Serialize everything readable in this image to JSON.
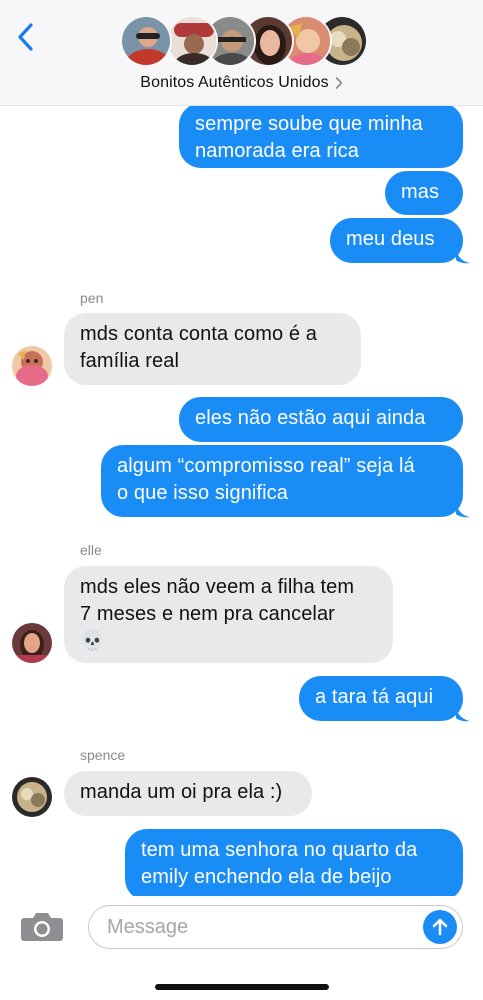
{
  "header": {
    "group_name": "Bonitos Autênticos Unidos",
    "back_icon": "chevron-left-icon",
    "avatar_colors": [
      "#c0392b",
      "#3b2a2a",
      "#4a4a4a",
      "#5b3b30",
      "#d98c70",
      "#2b2b2b"
    ]
  },
  "messages": [
    {
      "dir": "out",
      "text": "sempre soube que minha\nnamorada era rica"
    },
    {
      "dir": "out",
      "text": "mas"
    },
    {
      "dir": "out",
      "text": "meu deus"
    },
    {
      "dir": "in",
      "sender": "pen",
      "text": "mds conta conta como é a\nfamília real"
    },
    {
      "dir": "out",
      "text": "eles não estão aqui ainda"
    },
    {
      "dir": "out",
      "text": "algum “compromisso real” seja lá\no que isso significa"
    },
    {
      "dir": "in",
      "sender": "elle",
      "text": "mds eles não veem a filha tem\n7 meses e nem pra cancelar\n💀"
    },
    {
      "dir": "out",
      "text": "a tara tá aqui"
    },
    {
      "dir": "in",
      "sender": "spence",
      "text": "manda um oi pra ela :)"
    },
    {
      "dir": "out",
      "text": "tem uma senhora no quarto da\nemily enchendo ela de beijo"
    }
  ],
  "input": {
    "placeholder": "Message",
    "camera_icon": "camera-icon",
    "send_icon": "send-arrow-icon"
  },
  "colors": {
    "outgoing": "#1a8cf6",
    "incoming": "#e9e9eb",
    "accent": "#1a7cf5"
  }
}
